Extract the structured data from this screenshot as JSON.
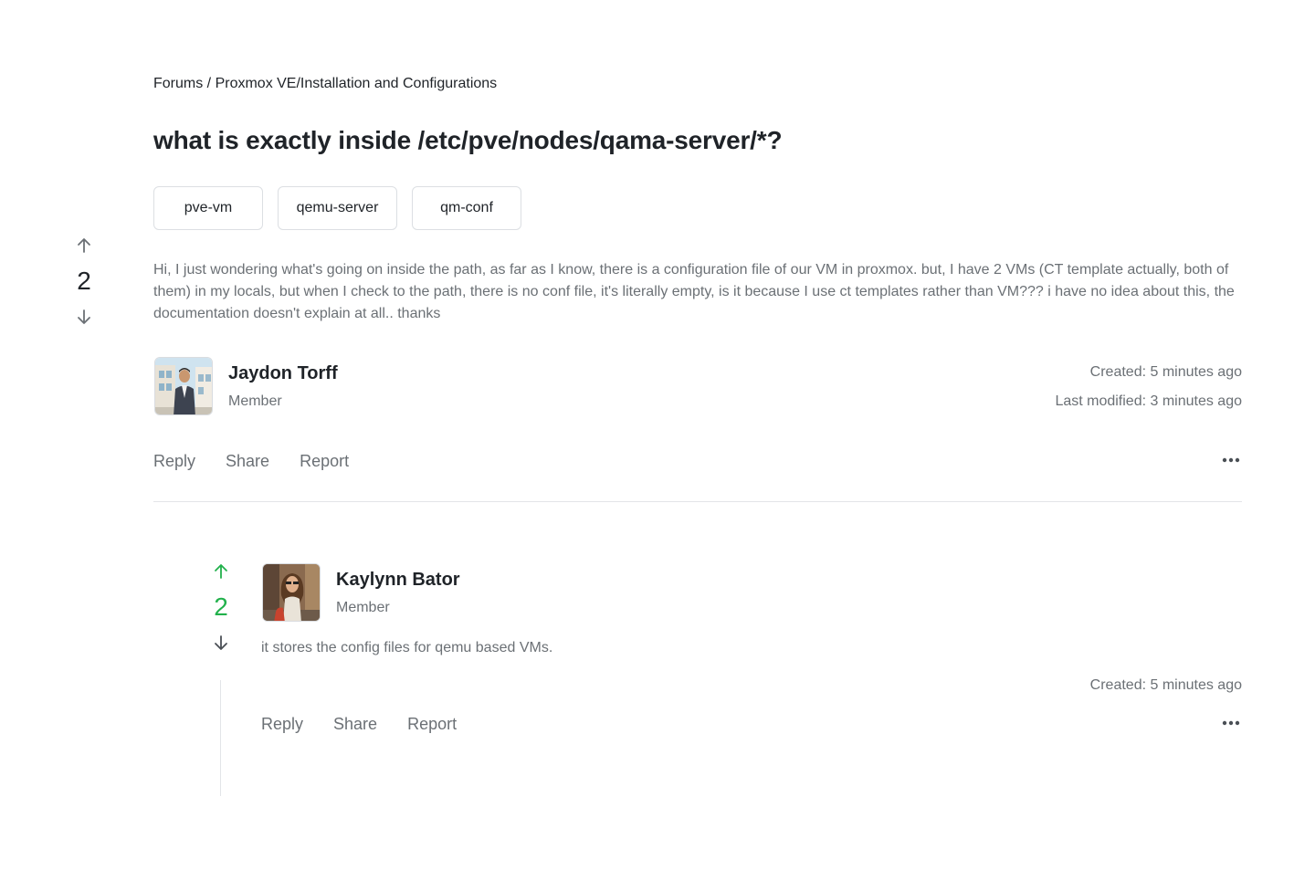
{
  "breadcrumb": "Forums / Proxmox VE/Installation and Configurations",
  "question": {
    "title": "what is exactly inside /etc/pve/nodes/qama-server/*?",
    "tags": [
      "pve-vm",
      "qemu-server",
      "qm-conf"
    ],
    "votes": "2",
    "body": "Hi, I just wondering what's going on inside the path, as far as I know, there is a configuration file of our VM in proxmox. but, I have 2 VMs (CT template actually, both of them) in my locals, but when I check to the path, there is no conf file, it's literally empty, is it because I use ct templates rather than VM??? i have no idea about this, the documentation doesn't explain at all.. thanks",
    "author": {
      "name": "Jaydon Torff",
      "role": "Member"
    },
    "created": "Created: 5 minutes ago",
    "modified": "Last modified: 3 minutes ago",
    "actions": {
      "reply": "Reply",
      "share": "Share",
      "report": "Report"
    }
  },
  "answer": {
    "votes": "2",
    "vote_color": "#22b14c",
    "author": {
      "name": "Kaylynn Bator",
      "role": "Member"
    },
    "body": "it stores the config files for qemu based VMs.",
    "created": "Created: 5 minutes ago",
    "actions": {
      "reply": "Reply",
      "share": "Share",
      "report": "Report"
    }
  },
  "icons": {
    "upvote": "arrow-up-icon",
    "downvote": "arrow-down-icon",
    "more": "more-horizontal-icon"
  }
}
